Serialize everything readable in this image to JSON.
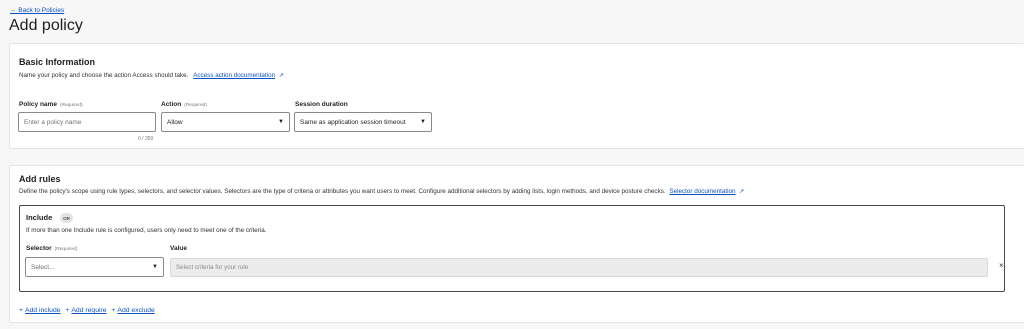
{
  "back_link": "← Back to Policies",
  "page_title": "Add policy",
  "basic": {
    "title": "Basic Information",
    "description": "Name your policy and choose the action Access should take.",
    "doc_link": "Access action documentation",
    "policy_name": {
      "label": "Policy name",
      "required": "(Required)",
      "placeholder": "Enter a policy name",
      "counter": "0 / 350"
    },
    "action": {
      "label": "Action",
      "required": "(Required)",
      "value": "Allow"
    },
    "session": {
      "label": "Session duration",
      "value": "Same as application session timeout"
    }
  },
  "rules": {
    "title": "Add rules",
    "description": "Define the policy's scope using rule types, selectors, and selector values. Selectors are the type of criteria or attributes you want users to meet. Configure additional selectors by adding lists, login methods, and device posture checks.",
    "doc_link": "Selector documentation",
    "include": {
      "title": "Include",
      "badge": "OR",
      "description": "If more than one Include rule is configured, users only need to meet one of the criteria.",
      "selector_label": "Selector",
      "selector_required": "(Required)",
      "selector_placeholder": "Select...",
      "value_label": "Value",
      "value_placeholder": "Select criteria for your rule",
      "remove_symbol": "×"
    },
    "actions": {
      "add_include": "Add include",
      "add_require": "Add require",
      "add_exclude": "Add exclude"
    }
  },
  "icons": {
    "external": "external-link-icon",
    "caret": "chevron-down-icon",
    "plus": "plus-icon"
  }
}
